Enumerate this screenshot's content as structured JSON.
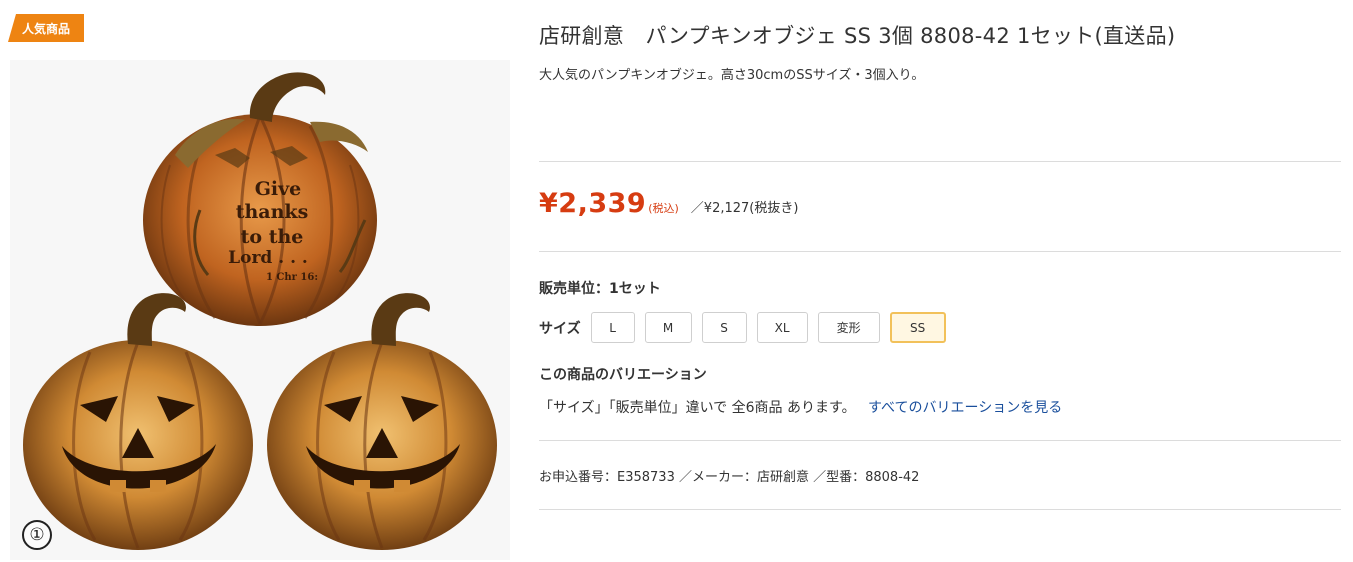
{
  "badge": {
    "label": "人気商品"
  },
  "image": {
    "number_label": "①",
    "engraving": [
      "Give",
      "thanks",
      "to the",
      "Lord . . .",
      "1 Chr 16:"
    ]
  },
  "product": {
    "title": "店研創意　パンプキンオブジェ SS 3個 8808-42 1セット(直送品)",
    "description": "大人気のパンプキンオブジェ。高さ30cmのSSサイズ・3個入り。"
  },
  "price": {
    "amount": "¥2,339",
    "tax_label": "(税込)",
    "excl": "／¥2,127(税抜き)"
  },
  "unit": {
    "text": "販売単位：1セット"
  },
  "size": {
    "label": "サイズ",
    "options": [
      "L",
      "M",
      "S",
      "XL",
      "変形",
      "SS"
    ],
    "selected": "SS"
  },
  "variation": {
    "title": "この商品のバリエーション",
    "text": "「サイズ」「販売単位」違いで 全6商品 あります。",
    "link": "すべてのバリエーションを見る"
  },
  "meta": {
    "text": "お申込番号：E358733 ／メーカー：店研創意 ／型番：8808-42"
  },
  "colors": {
    "price": "#d63c11",
    "badge": "#ee8412",
    "link": "#1a4f9c",
    "selected_border": "#f2c15a"
  }
}
